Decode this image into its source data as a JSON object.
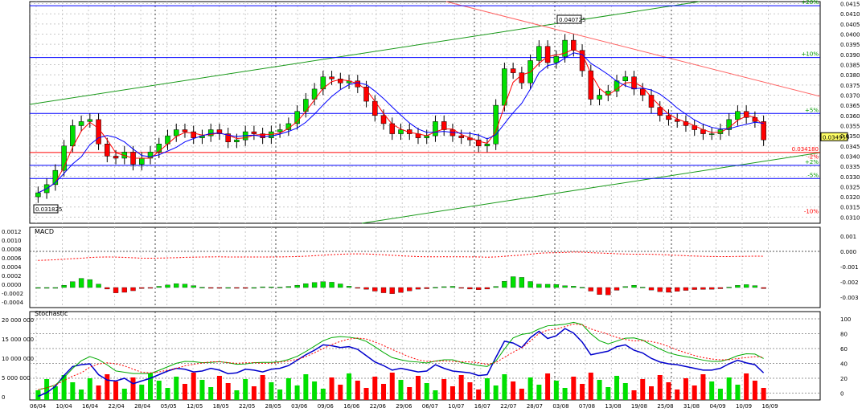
{
  "chart_data": {
    "type": "candlestick",
    "dates": [
      "06/04",
      "10/04",
      "16/04",
      "22/04",
      "28/04",
      "05/05",
      "12/05",
      "18/05",
      "22/05",
      "28/05",
      "03/06",
      "09/06",
      "16/06",
      "22/06",
      "29/06",
      "06/07",
      "10/07",
      "16/07",
      "22/07",
      "28/07",
      "03/08",
      "07/08",
      "13/08",
      "19/08",
      "25/08",
      "31/08",
      "04/09",
      "10/09",
      "16/09"
    ],
    "main": {
      "ylim": [
        0.0307,
        0.0416
      ],
      "y_ticks": [
        "0.0415",
        "0.0410",
        "0.0405",
        "0.0400",
        "0.0395",
        "0.0390",
        "0.0385",
        "0.0380",
        "0.0375",
        "0.0370",
        "0.0365",
        "0.0360",
        "0.0355",
        "0.0350",
        "0.0345",
        "0.0340",
        "0.0335",
        "0.0330",
        "0.0325",
        "0.0320",
        "0.0315",
        "0.0310"
      ],
      "close_series": [
        0.0322,
        0.0326,
        0.0333,
        0.0345,
        0.0355,
        0.0357,
        0.0358,
        0.0346,
        0.034,
        0.0339,
        0.0342,
        0.0336,
        0.0339,
        0.0342,
        0.0346,
        0.035,
        0.0353,
        0.0352,
        0.0349,
        0.035,
        0.0353,
        0.0351,
        0.0347,
        0.0348,
        0.0352,
        0.0351,
        0.0349,
        0.0352,
        0.0353,
        0.0356,
        0.0362,
        0.0368,
        0.0373,
        0.0379,
        0.0378,
        0.0376,
        0.0377,
        0.0374,
        0.0367,
        0.036,
        0.0356,
        0.0351,
        0.0353,
        0.0351,
        0.0349,
        0.035,
        0.0357,
        0.0353,
        0.035,
        0.0349,
        0.0348,
        0.0345,
        0.0346,
        0.0365,
        0.0383,
        0.0381,
        0.0376,
        0.0387,
        0.0394,
        0.0386,
        0.0389,
        0.0397,
        0.0392,
        0.0382,
        0.0368,
        0.037,
        0.0372,
        0.0377,
        0.0379,
        0.0373,
        0.037,
        0.0364,
        0.036,
        0.0358,
        0.0357,
        0.0355,
        0.0353,
        0.0351,
        0.0351,
        0.0353,
        0.0358,
        0.0362,
        0.0359,
        0.0357,
        0.0348
      ],
      "sma_fast_color": "#ff0000",
      "sma_slow_color": "#0000ff",
      "horizontal_levels": [
        {
          "value": 0.03355,
          "label": "+2%",
          "color": "#0000ff"
        },
        {
          "value": 0.0361,
          "label": "+5%",
          "color": "#0000ff"
        },
        {
          "value": 0.03885,
          "label": "+10%",
          "color": "#0000ff"
        },
        {
          "value": 0.0414,
          "label": "+20%",
          "color": "#0000ff"
        },
        {
          "value": 0.0329,
          "label": "-5%",
          "color": "#0000ff"
        },
        {
          "value": 0.03418,
          "label": "0.034180",
          "color": "#ff0000"
        }
      ],
      "annotations": [
        {
          "label": "0.040725",
          "date": "03/08"
        },
        {
          "label": "0.031825",
          "date": "06/04"
        }
      ],
      "last_price_label": "0.034955",
      "extra_labels": [
        "-10%",
        "-2%"
      ]
    },
    "macd": {
      "title": "MACD",
      "left_ticks": [
        "0.0012",
        "0.0010",
        "0.0008",
        "0.0006",
        "0.0004",
        "0.0002",
        "0.0000",
        "-0.0002",
        "-0.0004"
      ],
      "right_ticks": [
        "0.001",
        "0.000",
        "-0.001",
        "-0.002",
        "-0.003"
      ]
    },
    "stochastic": {
      "title": "Stochastic",
      "left_ticks": [
        "20 000 000",
        "15 000 000",
        "10 000 000",
        "5 000 000",
        "0"
      ],
      "right_ticks": [
        "100",
        "80",
        "60",
        "40",
        "20",
        "0"
      ]
    },
    "colors": {
      "up": "#00e000",
      "down": "#ff0000",
      "grid": "#c8c8c8",
      "trend_up": "#1a9a1a",
      "trend_down": "#ff6464",
      "level": "#0000ff"
    }
  }
}
